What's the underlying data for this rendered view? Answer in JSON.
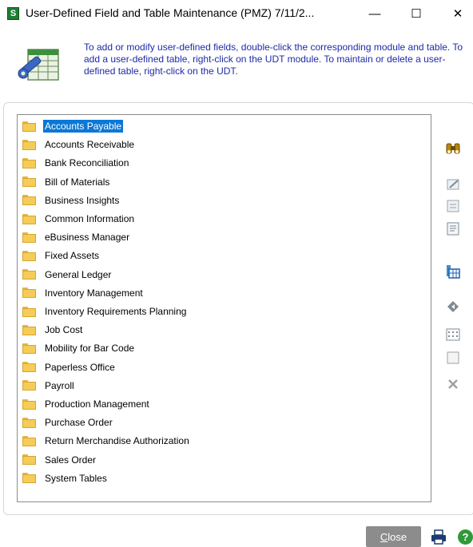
{
  "window": {
    "title": "User-Defined Field and Table Maintenance (PMZ) 7/11/2...",
    "app_icon_letter": "S",
    "minimize": "—",
    "maximize": "☐",
    "close": "✕"
  },
  "header": {
    "instructions": "To add or modify user-defined fields, double-click the corresponding module and table.  To add a user-defined table, right-click on the UDT module.  To maintain or delete a user-defined table, right-click on the UDT."
  },
  "tree": {
    "selected_index": 0,
    "items": [
      "Accounts Payable",
      "Accounts Receivable",
      "Bank Reconciliation",
      "Bill of Materials",
      "Business Insights",
      "Common Information",
      "eBusiness Manager",
      "Fixed Assets",
      "General Ledger",
      "Inventory Management",
      "Inventory Requirements Planning",
      "Job Cost",
      "Mobility for Bar Code",
      "Paperless Office",
      "Payroll",
      "Production Management",
      "Purchase Order",
      "Return Merchandise Authorization",
      "Sales Order",
      "System Tables"
    ]
  },
  "toolbar": {
    "icons": [
      "binoculars-icon",
      "edit-field-icon",
      "field-properties-icon",
      "form-icon",
      "table-grid-icon",
      "navigate-icon",
      "grid-layout-icon",
      "blank-page-icon",
      "delete-icon"
    ]
  },
  "footer": {
    "close_label_first": "C",
    "close_label_rest": "lose",
    "help_label": "?"
  },
  "colors": {
    "selection": "#0a78d7",
    "instruction_text": "#1f2aa6",
    "close_button": "#8c8c8c",
    "help_icon": "#2f9a3a",
    "folder": "#f5cc58"
  }
}
